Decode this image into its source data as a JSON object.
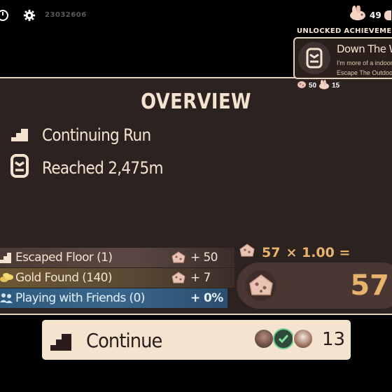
{
  "topbar": {
    "seed": "23032606",
    "currency_value": "49",
    "icons": [
      "exit-icon",
      "gear-icon",
      "cookie-bunny-icon"
    ]
  },
  "achievement": {
    "header": "UNLOCKED ACHIEVEMENTS",
    "name": "Down The Wall",
    "desc_line1": "I'm more of a indoor",
    "desc_line2": "Escape The Outdoors",
    "reward_cookies": "50",
    "reward_bunnies": "15"
  },
  "overview": {
    "title": "OVERVIEW",
    "stats": [
      {
        "icon": "stairs-icon",
        "label": "Continuing Run"
      },
      {
        "icon": "height-marker-icon",
        "label": "Reached 2,475m"
      }
    ]
  },
  "bonuses": [
    {
      "label": "Escaped Floor (1)",
      "value": "+ 50",
      "icon": "stairs-icon",
      "value_icon": "cookie-icon"
    },
    {
      "label": "Gold Found (140)",
      "value": "+ 7",
      "icon": "gold-coins-icon",
      "value_icon": "cookie-icon"
    },
    {
      "label": "Playing with Friends (0)",
      "value": "+ 0%",
      "icon": "friends-icon"
    }
  ],
  "calculation": {
    "base": "57",
    "multiplier": "× 1.00 =",
    "total": "57"
  },
  "continue_button": {
    "label": "Continue",
    "ready_count": "13"
  },
  "colors": {
    "panel": "#2c2220",
    "cream": "#f3e3cf",
    "gold": "#e7b36d",
    "friends_bar": "#2f5a80",
    "total_pill": "#4a3632"
  }
}
